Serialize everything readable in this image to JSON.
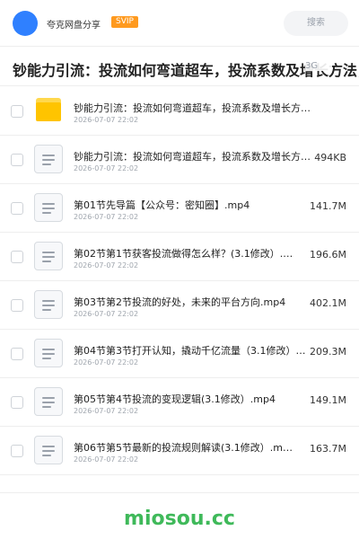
{
  "header": {
    "owner_name": "夸克网盘分享",
    "badge": "SVIP",
    "search_label": "搜索",
    "accent_color": "#2f80ff"
  },
  "share": {
    "title": "钞能力引流：投流如何弯道超车，投流系数及增长方法，创",
    "title_tail": "3G"
  },
  "files": [
    {
      "type": "folder",
      "name": "钞能力引流：投流如何弯道超车，投流系数及增长方法，…",
      "date": "2026-07-07 22:02",
      "size": ""
    },
    {
      "type": "file",
      "name": "钞能力引流：投流如何弯道超车，投流系数及增长方法，创…",
      "date": "2026-07-07 22:02",
      "size": "494KB"
    },
    {
      "type": "file",
      "name": "第01节先导篇【公众号：密知圈】.mp4",
      "date": "2026-07-07 22:02",
      "size": "141.7M"
    },
    {
      "type": "file",
      "name": "第02节第1节获客投流做得怎么样？(3.1修改）.…",
      "date": "2026-07-07 22:02",
      "size": "196.6M"
    },
    {
      "type": "file",
      "name": "第03节第2节投流的好处，未来的平台方向.mp4",
      "date": "2026-07-07 22:02",
      "size": "402.1M"
    },
    {
      "type": "file",
      "name": "第04节第3节打开认知，撬动千亿流量（3.1修改）…",
      "date": "2026-07-07 22:02",
      "size": "209.3M"
    },
    {
      "type": "file",
      "name": "第05节第4节投流的变现逻辑(3.1修改）.mp4",
      "date": "2026-07-07 22:02",
      "size": "149.1M"
    },
    {
      "type": "file",
      "name": "第06节第5节最新的投流规则解读(3.1修改）.m…",
      "date": "2026-07-07 22:02",
      "size": "163.7M"
    }
  ],
  "footer": {
    "watermark": "miosou.cc",
    "watermark_color": "#3fb95a"
  },
  "icons": {
    "folder": "folder-icon",
    "file": "document-icon",
    "avatar": "avatar"
  }
}
